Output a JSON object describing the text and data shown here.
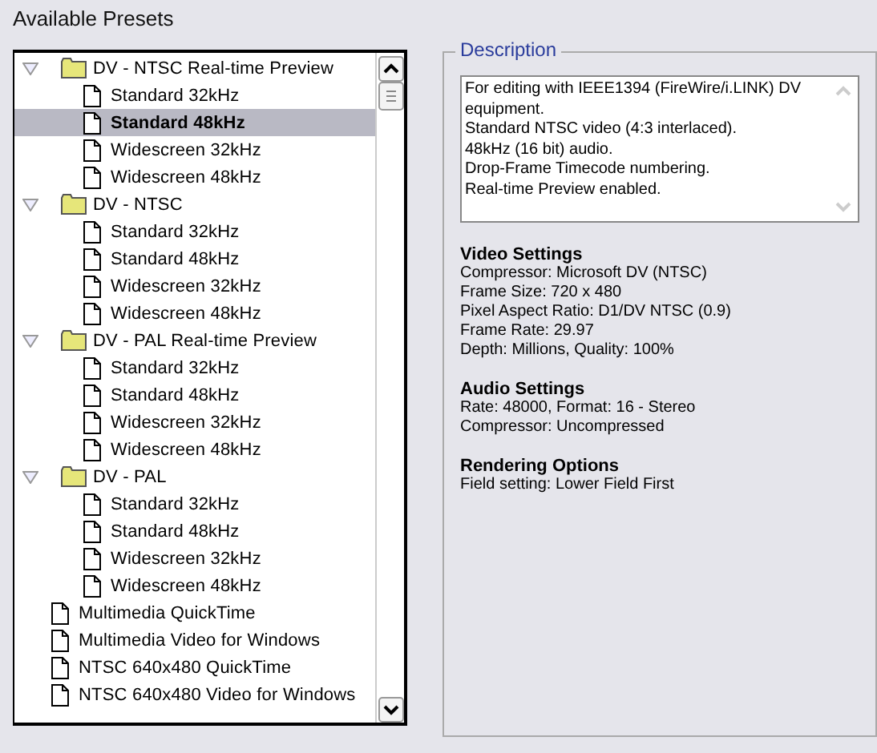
{
  "presets_label": "Available Presets",
  "tree": [
    {
      "kind": "folder",
      "label": "DV - NTSC Real-time Preview",
      "expanded": true,
      "selected": false,
      "children": [
        {
          "label": "Standard 32kHz",
          "selected": false
        },
        {
          "label": "Standard 48kHz",
          "selected": true
        },
        {
          "label": "Widescreen 32kHz",
          "selected": false
        },
        {
          "label": "Widescreen 48kHz",
          "selected": false
        }
      ]
    },
    {
      "kind": "folder",
      "label": "DV - NTSC",
      "expanded": true,
      "selected": false,
      "children": [
        {
          "label": "Standard 32kHz",
          "selected": false
        },
        {
          "label": "Standard 48kHz",
          "selected": false
        },
        {
          "label": "Widescreen 32kHz",
          "selected": false
        },
        {
          "label": "Widescreen 48kHz",
          "selected": false
        }
      ]
    },
    {
      "kind": "folder",
      "label": "DV - PAL Real-time Preview",
      "expanded": true,
      "selected": false,
      "children": [
        {
          "label": "Standard 32kHz",
          "selected": false
        },
        {
          "label": "Standard 48kHz",
          "selected": false
        },
        {
          "label": "Widescreen 32kHz",
          "selected": false
        },
        {
          "label": "Widescreen 48kHz",
          "selected": false
        }
      ]
    },
    {
      "kind": "folder",
      "label": "DV - PAL",
      "expanded": true,
      "selected": false,
      "children": [
        {
          "label": "Standard 32kHz",
          "selected": false
        },
        {
          "label": "Standard 48kHz",
          "selected": false
        },
        {
          "label": "Widescreen 32kHz",
          "selected": false
        },
        {
          "label": "Widescreen 48kHz",
          "selected": false
        }
      ]
    },
    {
      "kind": "file",
      "label": "Multimedia QuickTime",
      "selected": false
    },
    {
      "kind": "file",
      "label": "Multimedia Video for Windows",
      "selected": false
    },
    {
      "kind": "file",
      "label": "NTSC 640x480 QuickTime",
      "selected": false
    },
    {
      "kind": "file",
      "label": "NTSC 640x480 Video for Windows",
      "selected": false
    }
  ],
  "description": {
    "title": "Description",
    "lines": [
      "For editing with IEEE1394 (FireWire/i.LINK) DV equipment.",
      "Standard NTSC video (4:3 interlaced).",
      "48kHz (16 bit) audio.",
      "Drop-Frame Timecode numbering.",
      "Real-time Preview enabled."
    ]
  },
  "sections": [
    {
      "heading": "Video Settings",
      "lines": [
        "Compressor: Microsoft DV (NTSC)",
        "Frame Size: 720 x 480",
        "Pixel Aspect Ratio: D1/DV NTSC (0.9)",
        "Frame Rate: 29.97",
        "Depth: Millions, Quality: 100%"
      ]
    },
    {
      "heading": "Audio Settings",
      "lines": [
        "Rate: 48000, Format: 16 - Stereo",
        "Compressor: Uncompressed"
      ]
    },
    {
      "heading": "Rendering Options",
      "lines": [
        "Field setting: Lower Field First"
      ]
    }
  ]
}
